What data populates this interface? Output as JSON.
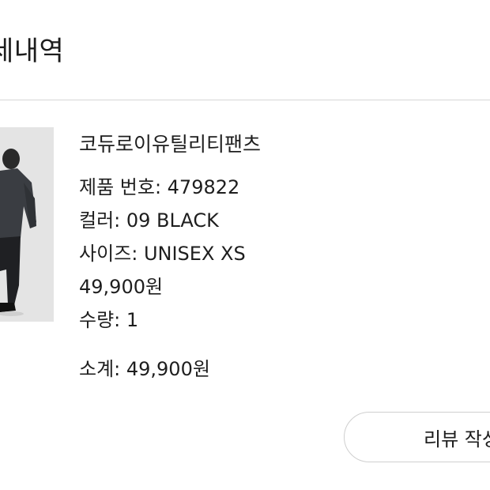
{
  "header": {
    "title": "세내역"
  },
  "order_item": {
    "product_name": "코듀로이유틸리티팬츠",
    "product_number": "제품 번호: 479822",
    "color": "컬러: 09 BLACK",
    "size": "사이즈: UNISEX XS",
    "price": "49,900원",
    "quantity": "수량: 1",
    "subtotal": "소계: 49,900원",
    "image_icon": "product-photo-person-in-black-outfit"
  },
  "actions": {
    "review_label": "리뷰 작성"
  }
}
